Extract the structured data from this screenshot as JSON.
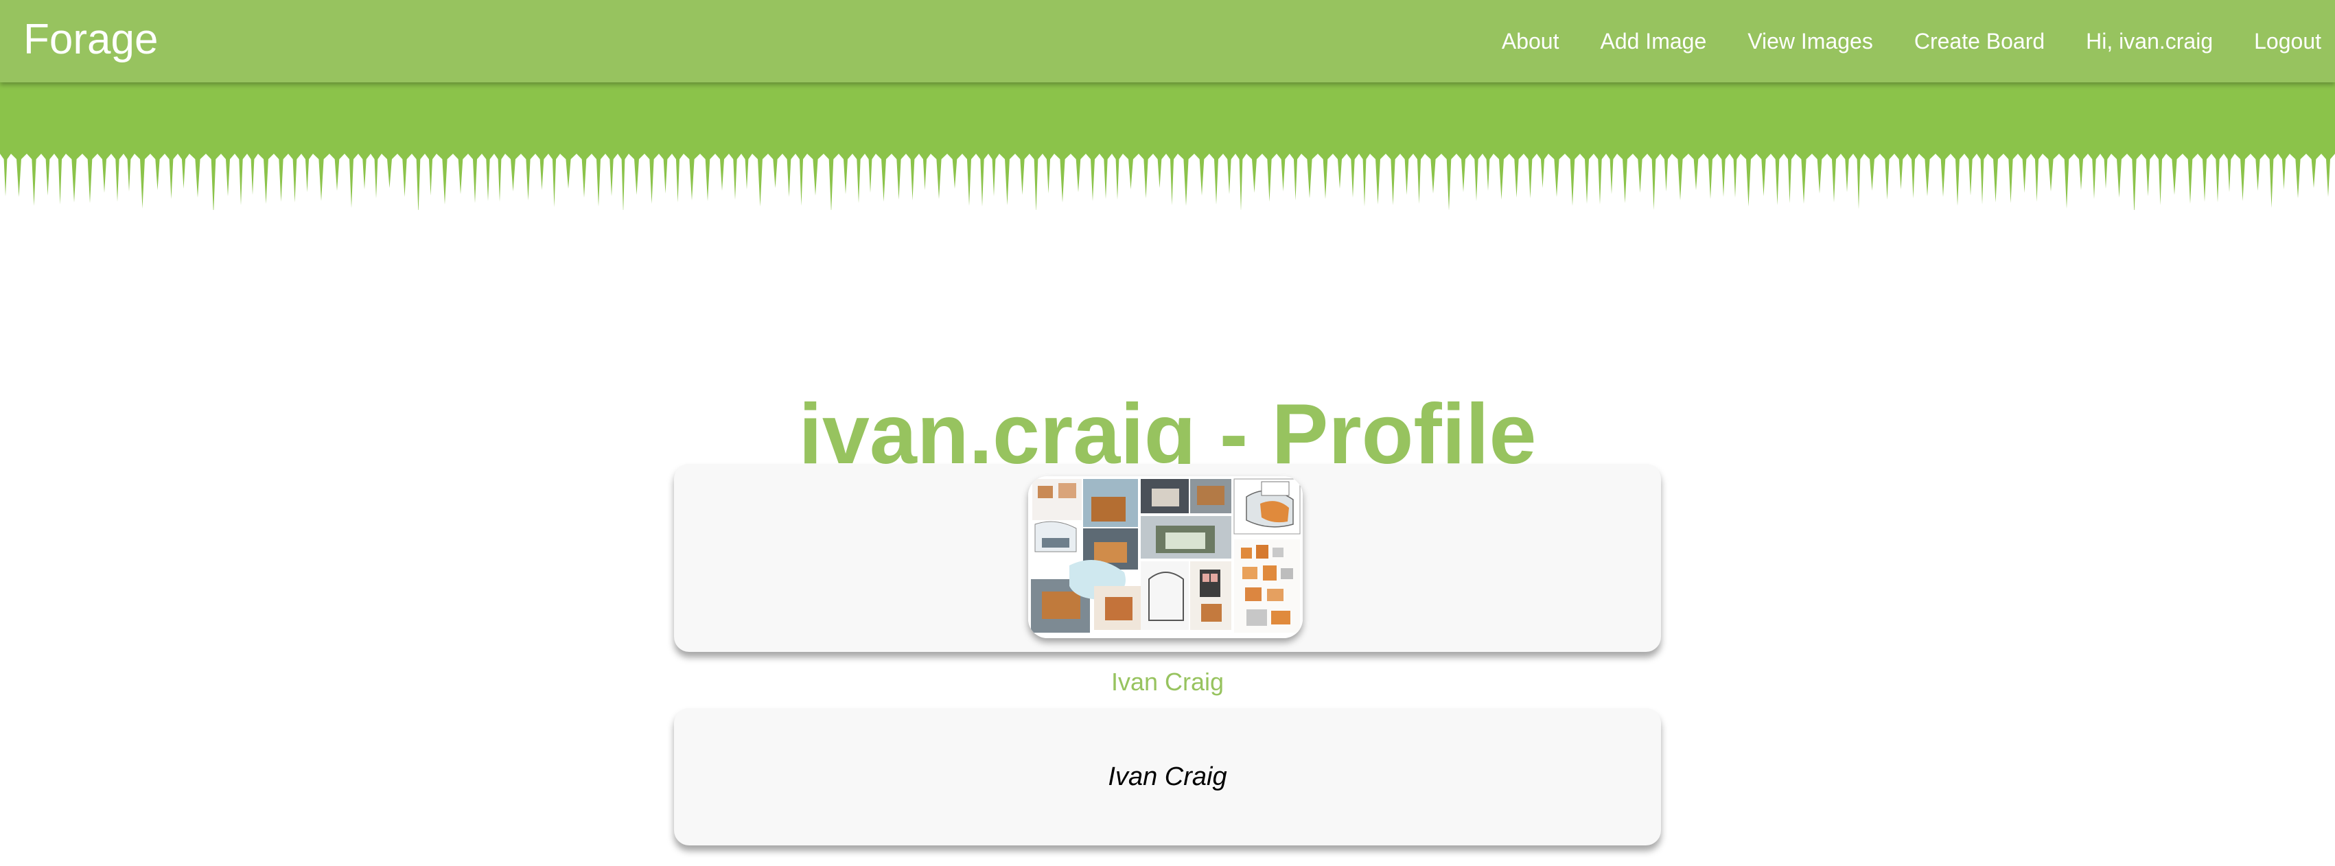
{
  "navbar": {
    "brand": "Forage",
    "links": [
      {
        "label": "About"
      },
      {
        "label": "Add Image"
      },
      {
        "label": "View Images"
      },
      {
        "label": "Create Board"
      },
      {
        "label": "Hi, ivan.craig"
      },
      {
        "label": "Logout"
      }
    ]
  },
  "colors": {
    "navbar": "#97c35f",
    "banner": "#8bc34a",
    "accent": "#97c35f",
    "card": "#f8f8f8"
  },
  "profile": {
    "title": "ivan.craig - Profile",
    "image_icon": "sketch-collage-image",
    "display_name": "Ivan Craig",
    "card_name": "Ivan Craig"
  }
}
